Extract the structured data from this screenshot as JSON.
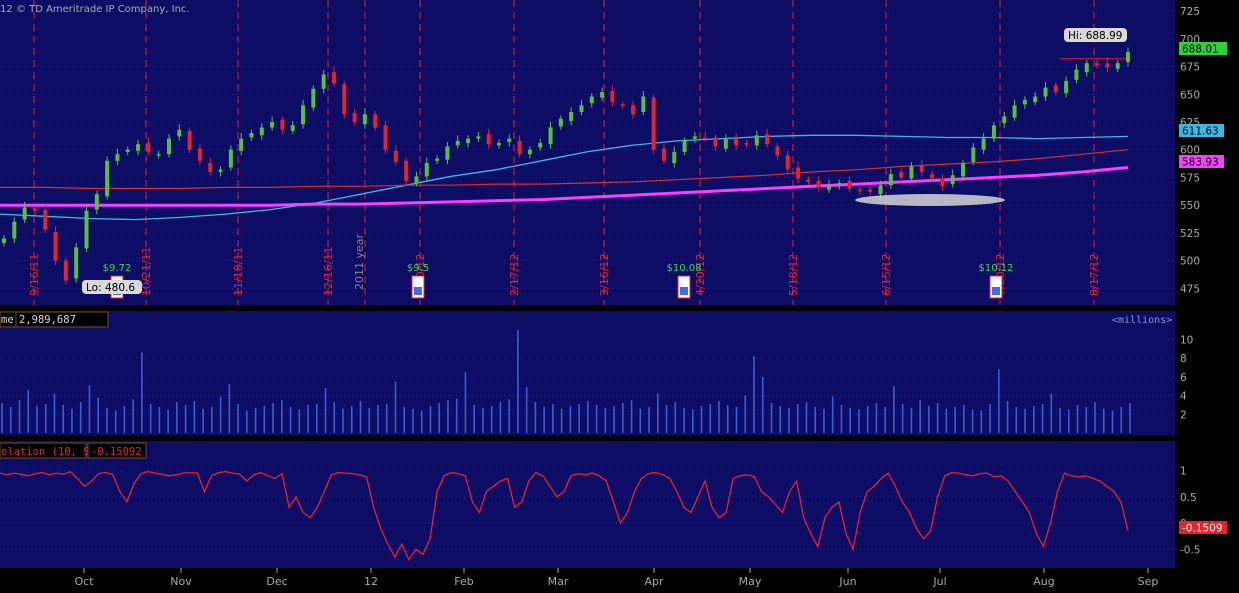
{
  "colors": {
    "panel_bg": "#0d0d66",
    "outer_bg": "#000000",
    "candle_up": "#56c23a",
    "candle_down": "#e8212a",
    "ma_cyan": "#3fb7e6",
    "ma_red": "#d8302b",
    "ma_magenta": "#ff3cff",
    "volume_bar": "#3c5bd8",
    "correlation_line": "#e8212a",
    "event_line": "#e8212a",
    "axis_text": "#a9a9a9",
    "earnings_text": "#39d84a"
  },
  "header": {
    "copyright": "12 © TD Ameritrade IP Company, Inc."
  },
  "price_panel": {
    "hi_label": "Hi: 688.99",
    "lo_label": "Lo: 480.6",
    "last_price_badge": "688.01",
    "ma_cyan_badge": "611.63",
    "ma_magenta_badge": "583.93",
    "year_marker": "2011 year",
    "event_labels": [
      "9/16/11",
      "10/21/11",
      "11/18/11",
      "12/16/11",
      "1/20/12",
      "2/17/12",
      "3/16/12",
      "4/20/12",
      "5/18/12",
      "6/15/12",
      "7/20/12",
      "8/17/12"
    ],
    "earnings_labels": [
      "$9.72",
      "$9.5",
      "$10.08",
      "$10.12"
    ]
  },
  "volume_panel": {
    "title": "me",
    "value": "2,989,687",
    "units": "<millions>"
  },
  "correlation_panel": {
    "title": "elation (10, SPX)",
    "value": "-0.15092",
    "badge": "-0.1509"
  },
  "x_axis": {
    "months": [
      "Oct",
      "Nov",
      "Dec",
      "12",
      "Feb",
      "Mar",
      "Apr",
      "May",
      "Jun",
      "Jul",
      "Aug",
      "Sep"
    ]
  },
  "chart_data": [
    {
      "type": "candlestick",
      "ylim": [
        460,
        735
      ],
      "yticks": [
        475,
        500,
        525,
        550,
        575,
        600,
        625,
        650,
        675,
        700,
        725
      ],
      "grid": true,
      "series": [
        {
          "name": "Close",
          "close": [
            520,
            535,
            548,
            545,
            528,
            500,
            482,
            512,
            545,
            560,
            590,
            596,
            600,
            605,
            598,
            596,
            610,
            618,
            600,
            590,
            580,
            582,
            600,
            610,
            615,
            620,
            625,
            618,
            622,
            640,
            655,
            668,
            660,
            632,
            625,
            632,
            620,
            600,
            589,
            572,
            576,
            588,
            592,
            603,
            608,
            610,
            612,
            605,
            606,
            610,
            596,
            600,
            606,
            620,
            628,
            634,
            640,
            648,
            652,
            643,
            640,
            632,
            648,
            600,
            590,
            598,
            608,
            612,
            610,
            603,
            610,
            604,
            605,
            613,
            605,
            595,
            582,
            574,
            571,
            566,
            568,
            570,
            565,
            563,
            562,
            568,
            578,
            575,
            585,
            580,
            574,
            567,
            577,
            588,
            602,
            610,
            622,
            630,
            640,
            645,
            648,
            656,
            652,
            662,
            672,
            678,
            676,
            674,
            678,
            688
          ]
        },
        {
          "name": "MA cyan",
          "values": [
            542,
            540,
            538,
            537,
            539,
            542,
            546,
            552,
            560,
            568,
            576,
            582,
            590,
            598,
            604,
            608,
            610,
            612,
            613,
            613,
            612,
            611,
            611,
            610,
            611,
            612
          ]
        },
        {
          "name": "MA red",
          "values": [
            566,
            566,
            565,
            565,
            565,
            566,
            566,
            567,
            567,
            568,
            568,
            569,
            569,
            570,
            571,
            573,
            575,
            577,
            580,
            582,
            585,
            587,
            589,
            592,
            596,
            600
          ]
        },
        {
          "name": "MA magenta",
          "values": [
            550,
            550,
            550,
            550,
            550,
            550,
            550,
            551,
            551,
            552,
            553,
            554,
            555,
            557,
            559,
            561,
            563,
            565,
            567,
            569,
            571,
            573,
            575,
            577,
            580,
            584
          ]
        }
      ]
    },
    {
      "type": "bar",
      "title": "Volume",
      "ylabel": "<millions>",
      "ylim": [
        0,
        11
      ],
      "yticks": [
        2,
        4,
        6,
        8,
        10
      ],
      "values": [
        3.2,
        2.8,
        3.5,
        4.6,
        2.9,
        3.1,
        4.2,
        3.0,
        2.6,
        3.3,
        5.1,
        3.8,
        2.7,
        2.4,
        2.9,
        3.6,
        8.6,
        3.1,
        2.8,
        2.5,
        3.3,
        3.0,
        3.4,
        2.6,
        2.8,
        3.9,
        5.2,
        3.1,
        2.4,
        2.7,
        2.9,
        3.2,
        3.5,
        2.8,
        2.5,
        3.0,
        3.1,
        4.8,
        3.3,
        2.6,
        2.9,
        3.4,
        2.7,
        3.0,
        3.1,
        5.5,
        2.8,
        2.6,
        2.4,
        2.9,
        3.2,
        3.5,
        3.7,
        6.5,
        3.0,
        2.7,
        2.9,
        3.3,
        3.6,
        11.0,
        4.9,
        3.3,
        2.8,
        3.1,
        2.6,
        2.9,
        3.1,
        3.4,
        3.0,
        2.7,
        2.9,
        3.2,
        3.5,
        2.6,
        2.8,
        4.2,
        3.0,
        3.3,
        2.7,
        2.5,
        2.9,
        3.1,
        3.4,
        3.0,
        2.8,
        4.0,
        8.2,
        6.0,
        3.2,
        2.9,
        2.7,
        3.1,
        3.3,
        2.8,
        2.6,
        3.9,
        3.0,
        2.7,
        2.5,
        2.9,
        3.2,
        2.8,
        5.0,
        3.1,
        2.7,
        3.5,
        2.9,
        3.2,
        2.6,
        2.8,
        3.0,
        2.5,
        2.4,
        3.1,
        6.8,
        3.4,
        2.8,
        2.6,
        2.9,
        3.1,
        4.2,
        2.7,
        2.5,
        3.0,
        2.8,
        3.3,
        2.6,
        2.4,
        2.8,
        3.2
      ]
    },
    {
      "type": "line",
      "title": "Correlation (10, SPX)",
      "ylim": [
        -0.8,
        1.2
      ],
      "yticks": [
        -0.5,
        0,
        0.5,
        1
      ],
      "values": [
        0.95,
        0.92,
        0.95,
        0.93,
        0.9,
        0.94,
        0.96,
        0.92,
        0.95,
        0.93,
        0.98,
        0.85,
        0.7,
        0.8,
        0.94,
        0.96,
        0.92,
        0.6,
        0.4,
        0.75,
        0.94,
        0.98,
        0.95,
        0.93,
        0.9,
        0.92,
        0.95,
        0.96,
        0.95,
        0.6,
        0.9,
        0.96,
        0.98,
        0.95,
        0.93,
        0.8,
        0.92,
        0.96,
        0.9,
        0.85,
        0.94,
        0.3,
        0.5,
        0.2,
        0.1,
        0.3,
        0.6,
        0.92,
        0.96,
        0.95,
        0.94,
        0.92,
        0.88,
        0.3,
        -0.1,
        -0.4,
        -0.65,
        -0.4,
        -0.7,
        -0.5,
        -0.6,
        -0.3,
        0.6,
        0.9,
        0.96,
        0.94,
        0.9,
        0.4,
        0.2,
        0.6,
        0.7,
        0.8,
        0.85,
        0.3,
        0.4,
        0.8,
        0.96,
        0.9,
        0.7,
        0.5,
        0.6,
        0.9,
        0.94,
        0.92,
        0.95,
        0.9,
        0.8,
        0.4,
        0.0,
        0.2,
        0.6,
        0.85,
        0.94,
        0.96,
        0.92,
        0.85,
        0.6,
        0.3,
        0.2,
        0.5,
        0.8,
        0.3,
        0.1,
        0.2,
        0.85,
        0.9,
        0.92,
        0.88,
        0.6,
        0.5,
        0.35,
        0.2,
        0.6,
        0.8,
        0.1,
        -0.2,
        -0.45,
        0.1,
        0.3,
        0.4,
        -0.2,
        -0.5,
        0.2,
        0.6,
        0.7,
        0.85,
        0.95,
        0.7,
        0.4,
        0.2,
        -0.1,
        -0.3,
        -0.15,
        0.5,
        0.9,
        0.96,
        0.95,
        0.92,
        0.9,
        0.94,
        0.95,
        0.88,
        0.9,
        0.8,
        0.6,
        0.4,
        0.2,
        -0.2,
        -0.45,
        0.0,
        0.6,
        0.95,
        0.9,
        0.88,
        0.9,
        0.85,
        0.8,
        0.7,
        0.6,
        0.4,
        -0.15
      ]
    }
  ]
}
